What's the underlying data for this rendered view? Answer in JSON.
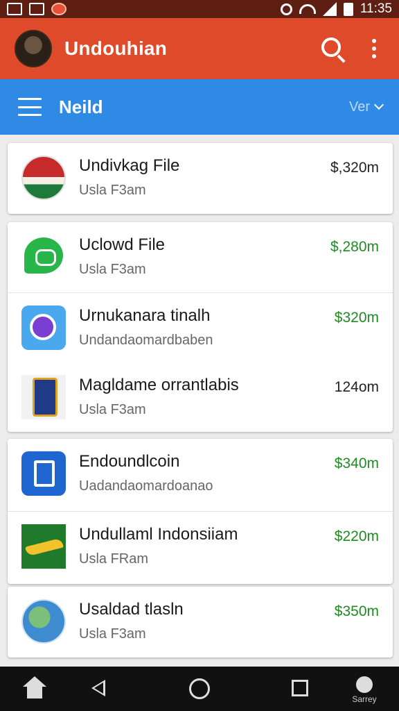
{
  "status_bar": {
    "time": "11:35"
  },
  "app_bar": {
    "title": "Undouhian"
  },
  "sub_bar": {
    "title": "Neild",
    "view_label": "Ver"
  },
  "items": [
    {
      "title": "Undivkag File",
      "subtitle": "Usla F3am",
      "price": "$,320m",
      "icon": "flag-badge-icon",
      "price_color": "#222222"
    },
    {
      "title": "Uclowd File",
      "subtitle": "Usla F3am",
      "price": "$,280m",
      "icon": "chat-bubble-icon",
      "price_color": "#1f8a22"
    },
    {
      "title": "Urnukanara tinalh",
      "subtitle": "Undandaomardbaben",
      "price": "$320m",
      "icon": "camera-app-icon",
      "price_color": "#1f8a22"
    },
    {
      "title": "Magldame orrantlabis",
      "subtitle": "Usla F3am",
      "price": "124om",
      "icon": "phone-app-icon",
      "price_color": "#222222"
    },
    {
      "title": "Endoundlcoin",
      "subtitle": "Uadandaomardoanao",
      "price": "$340m",
      "icon": "tablet-app-icon",
      "price_color": "#1f8a22"
    },
    {
      "title": "Undullaml Indonsiiam",
      "subtitle": "Usla FRam",
      "price": "$220m",
      "icon": "plane-app-icon",
      "price_color": "#1f8a22"
    },
    {
      "title": "Usaldad tlasln",
      "subtitle": "Usla F3am",
      "price": "$350m",
      "icon": "globe-app-icon",
      "price_color": "#1f8a22"
    }
  ],
  "nav_bar": {
    "assist_label": "Sarrey"
  }
}
